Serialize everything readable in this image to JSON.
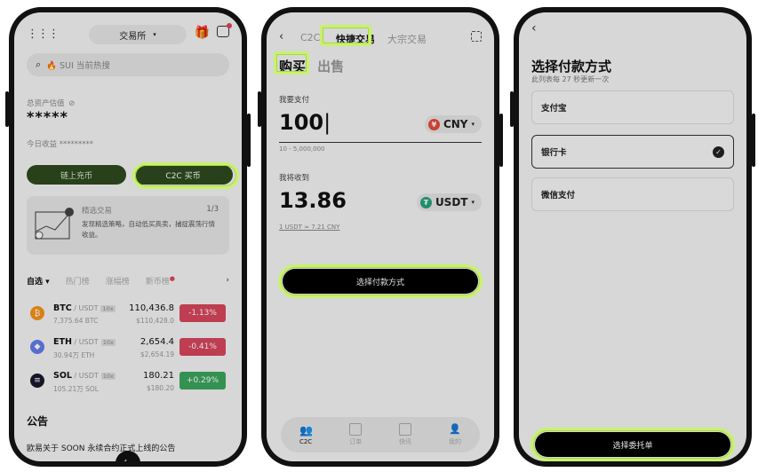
{
  "phone1": {
    "exchange_label": "交易所",
    "search_placeholder": "🔥 SUI 当前热搜",
    "total_assets_label": "总资产估值",
    "total_assets_value": "*****",
    "today_pnl_label": "今日收益 *********",
    "onchain_button": "链上充币",
    "c2c_button": "C2C 买币",
    "featured_title": "精选交易",
    "featured_counter": "1/3",
    "featured_desc": "发现精选策略，自动低买高卖，捕捉震荡行情收益。",
    "tabs": [
      "自选",
      "热门榜",
      "涨幅榜",
      "新币榜"
    ],
    "coins": [
      {
        "symbol": "BTC",
        "pair": " / USDT",
        "lev": "10x",
        "vol": "7,375.64 BTC",
        "price": "110,436.8",
        "usd": "$110,428.0",
        "change": "-1.13%",
        "color": "#f7931a",
        "chg_color": "#d9465d",
        "icon": "₿"
      },
      {
        "symbol": "ETH",
        "pair": " / USDT",
        "lev": "10x",
        "vol": "30.94万 ETH",
        "price": "2,654.4",
        "usd": "$2,654.19",
        "change": "-0.41%",
        "color": "#627eea",
        "chg_color": "#d9465d",
        "icon": "◆"
      },
      {
        "symbol": "SOL",
        "pair": " / USDT",
        "lev": "10x",
        "vol": "105.21万 SOL",
        "price": "180.21",
        "usd": "$180.20",
        "change": "+0.29%",
        "color": "#1a1a2e",
        "chg_color": "#3ba55d",
        "icon": "≡"
      }
    ],
    "announcement_title": "公告",
    "announcement_text": "欧易关于 SOON 永续合约正式上线的公告"
  },
  "phone2": {
    "nav_tabs": [
      "C2C",
      "快捷交易",
      "大宗交易"
    ],
    "buy_tab": "购买",
    "sell_tab": "出售",
    "pay_label": "我要支付",
    "pay_amount": "100",
    "pay_currency": "CNY",
    "pay_range": "10 - 5,000,000",
    "receive_label": "我将收到",
    "receive_amount": "13.86",
    "receive_currency": "USDT",
    "rate": "1 USDT ≈ 7.21 CNY",
    "select_payment_button": "选择付款方式",
    "bottom_nav": [
      "C2C",
      "订单",
      "快讯",
      "我的"
    ]
  },
  "phone3": {
    "title": "选择付款方式",
    "subtitle": "此列表每 27 秒更新一次",
    "options": [
      "支付宝",
      "银行卡",
      "微信支付"
    ],
    "confirm_button": "选择委托单"
  },
  "colors": {
    "highlight": "#c8f26a",
    "dark_green": "#2e4a1e",
    "down_red": "#d9465d",
    "up_green": "#3ba55d"
  }
}
